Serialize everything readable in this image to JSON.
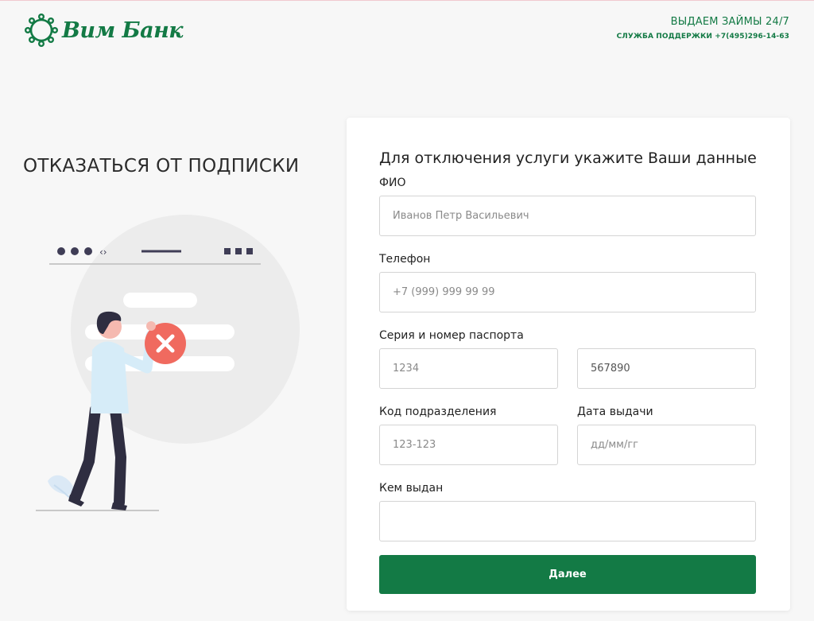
{
  "header": {
    "logo_text": "Вим Банк",
    "loans_text": "ВЫДАЕМ ЗАЙМЫ 24/7",
    "support_text": "СЛУЖБА ПОДДЕРЖКИ +7(495)296-14-63"
  },
  "left": {
    "title": "ОТКАЗАТЬСЯ ОТ ПОДПИСКИ"
  },
  "form": {
    "heading": "Для отключения услуги укажите Ваши данные",
    "fio": {
      "label": "ФИО",
      "value": "",
      "placeholder": "Иванов Петр Васильевич"
    },
    "phone": {
      "label": "Телефон",
      "value": "",
      "placeholder": "+7 (999) 999 99 99"
    },
    "passport": {
      "label": "Серия и номер паспорта",
      "series": {
        "value": "",
        "placeholder": "1234"
      },
      "number": {
        "value": "567890",
        "placeholder": ""
      }
    },
    "division": {
      "label": "Код подразделения",
      "value": "",
      "placeholder": "123-123"
    },
    "issue_date": {
      "label": "Дата выдачи",
      "value": "",
      "placeholder": "дд/мм/гг"
    },
    "issued_by": {
      "label": "Кем выдан",
      "value": "",
      "placeholder": ""
    },
    "submit_label": "Далее"
  },
  "colors": {
    "brand": "#137a45",
    "background": "#f7f7f7",
    "error": "#f06a5f"
  }
}
